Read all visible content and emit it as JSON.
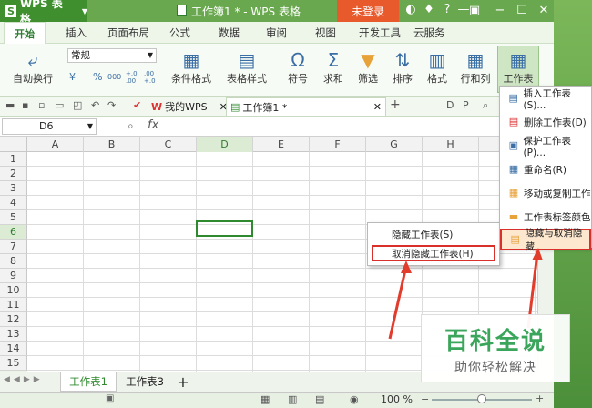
{
  "app": {
    "name": "WPS 表格",
    "doc_title": "工作簿1 * - WPS 表格",
    "login": "未登录"
  },
  "menu": [
    "开始",
    "插入",
    "页面布局",
    "公式",
    "数据",
    "审阅",
    "视图",
    "开发工具",
    "云服务"
  ],
  "ribbon": {
    "wrap": "自动换行",
    "number_format": "常规",
    "currency": "¥",
    "percent": "%",
    "thousands": "000",
    "inc_decimal": "+.0 .00",
    "dec_decimal": ".00 +.0",
    "cond_format": "条件格式",
    "table_style": "表格样式",
    "symbol": "符号",
    "sum": "求和",
    "filter": "筛选",
    "sort": "排序",
    "format": "格式",
    "rowcol": "行和列",
    "worksheet": "工作表"
  },
  "tabs": {
    "mywps": "我的WPS",
    "book": "工作簿1 *"
  },
  "namebox": "D6",
  "fx": "fx",
  "columns": [
    "A",
    "B",
    "C",
    "D",
    "E",
    "F",
    "G",
    "H"
  ],
  "rows": [
    "1",
    "2",
    "3",
    "4",
    "5",
    "6",
    "7",
    "8",
    "9",
    "10",
    "11",
    "12",
    "13",
    "14",
    "15"
  ],
  "context_menu": {
    "hide": "隐藏工作表(S)",
    "unhide": "取消隐藏工作表(H)"
  },
  "sheet_menu": {
    "insert": "插入工作表(S)...",
    "delete": "删除工作表(D)",
    "protect": "保护工作表(P)...",
    "rename": "重命名(R)",
    "move": "移动或复制工作",
    "tabcolor": "工作表标签颜色",
    "hide_unhide": "隐藏与取消隐藏"
  },
  "sheets": [
    "工作表1",
    "工作表3"
  ],
  "add_sheet": "+",
  "zoom": "100 %",
  "watermark": {
    "big": "百科全说",
    "small": "助你轻松解决"
  }
}
